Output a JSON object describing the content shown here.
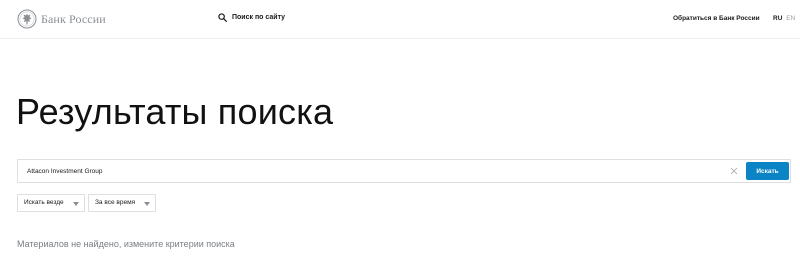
{
  "header": {
    "logo_text": "Банк России",
    "site_search_label": "Поиск по сайту",
    "contact_link": "Обратиться в Банк России",
    "languages": {
      "ru": "RU",
      "en": "EN"
    }
  },
  "main": {
    "title": "Результаты поиска",
    "search": {
      "value": "Attacon Investment Group",
      "button_label": "Искать"
    },
    "filters": {
      "place": "Искать везде",
      "time": "За все время"
    },
    "no_results_message": "Материалов не найдено, измените критерии поиска"
  },
  "colors": {
    "accent": "#0a84c4",
    "muted_text": "#7a7f86",
    "border": "#dcdfe3"
  }
}
